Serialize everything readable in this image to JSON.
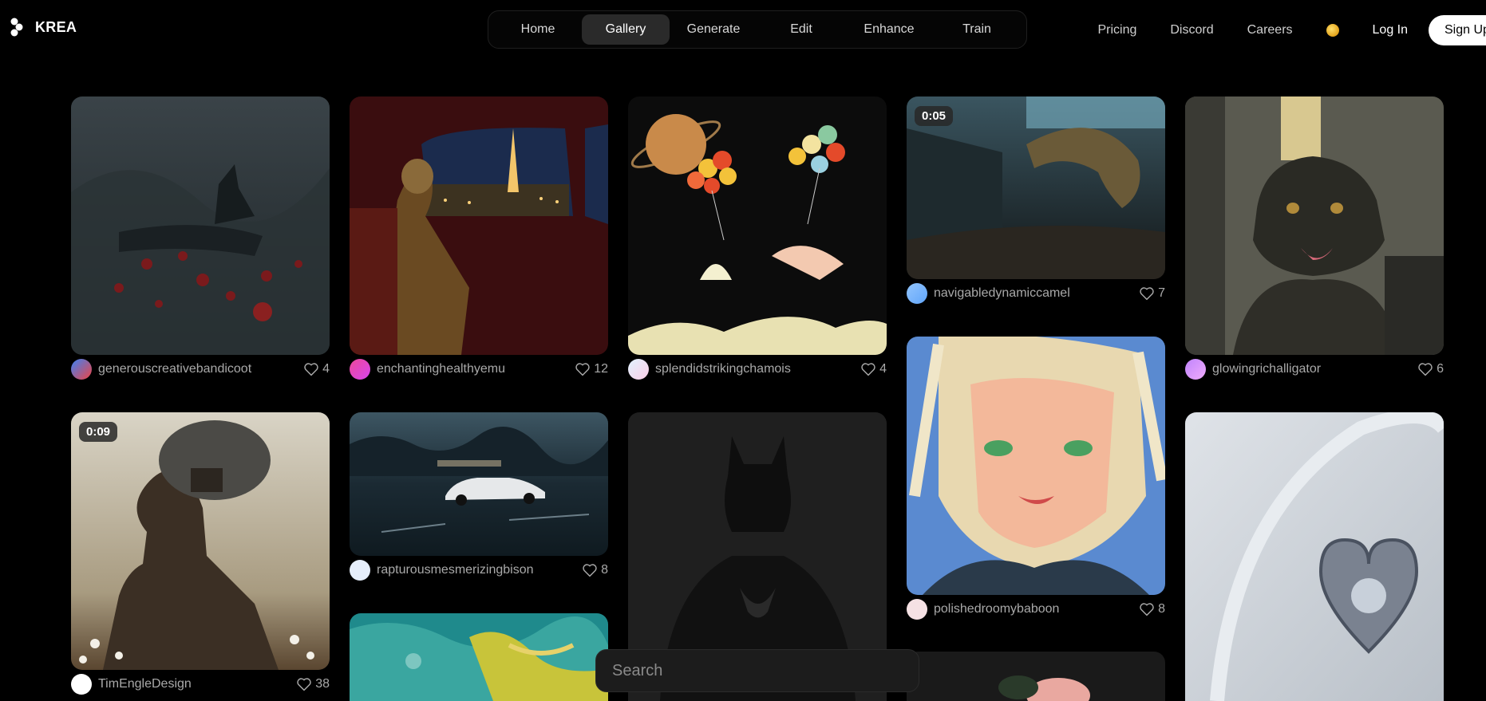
{
  "brand": {
    "name": "KREA"
  },
  "nav": {
    "items": [
      {
        "label": "Home"
      },
      {
        "label": "Gallery"
      },
      {
        "label": "Generate"
      },
      {
        "label": "Edit"
      },
      {
        "label": "Enhance"
      },
      {
        "label": "Train"
      }
    ],
    "active": "Gallery"
  },
  "header_links": {
    "pricing": "Pricing",
    "discord": "Discord",
    "careers": "Careers",
    "login": "Log In",
    "signup": "Sign Up"
  },
  "search": {
    "placeholder": "Search"
  },
  "colors": {
    "background": "#000000",
    "nav_active": "#2a2a2a",
    "text_muted": "#a9a9a9"
  },
  "gallery": [
    {
      "user": "generouscreativebandicoot",
      "likes": "4"
    },
    {
      "user": "enchantinghealthyemu",
      "likes": "12"
    },
    {
      "user": "splendidstrikingchamois",
      "likes": "4"
    },
    {
      "user": "navigabledynamiccamel",
      "likes": "7",
      "duration": "0:05"
    },
    {
      "user": "glowingrichalligator",
      "likes": "6"
    },
    {
      "user": "TimEngleDesign",
      "likes": "38",
      "duration": "0:09"
    },
    {
      "user": "rapturousmesmerizingbison",
      "likes": "8"
    },
    {
      "user": "polishedroomybaboon",
      "likes": "8"
    }
  ]
}
